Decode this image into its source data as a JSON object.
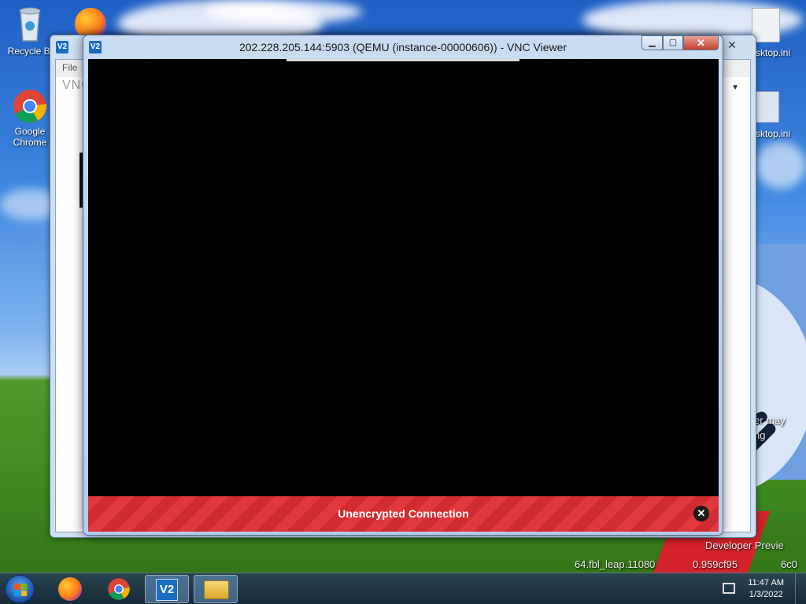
{
  "desktop": {
    "icons": [
      {
        "label": "Recycle Bi",
        "icon": "recycle-bin-icon"
      },
      {
        "label": "Google Chrome",
        "icon": "chrome-icon"
      }
    ],
    "right_labels": [
      "sktop.ini",
      "sktop.ini"
    ],
    "watermark_lines": [
      "er may",
      "ng",
      "Developer Previe",
      "64.fbl_leap.11080",
      "0.959cf95",
      "6c0"
    ]
  },
  "bg_window": {
    "menu_file": "File",
    "brand": "VNC",
    "close_glyph": "✕",
    "dropdown_glyph": "▼"
  },
  "vnc_window": {
    "app_icon_text": "V2",
    "title": "202.228.205.144:5903 (QEMU (instance-00000606)) - VNC Viewer",
    "min_glyph": "▁",
    "max_glyph": "▢",
    "close_glyph": "✕",
    "warning": {
      "text": "Unencrypted Connection",
      "close_glyph": "✕"
    }
  },
  "taskbar": {
    "items": [
      {
        "icon": "firefox-icon"
      },
      {
        "icon": "chrome-icon"
      },
      {
        "icon": "vnc-viewer-icon",
        "label": "V2"
      },
      {
        "icon": "file-explorer-icon"
      }
    ],
    "clock": {
      "time": "11:47 AM",
      "date": "1/3/2022"
    }
  },
  "colors": {
    "warning_red": "#e0383d",
    "window_frame": "#c9dcf3",
    "close_red": "#c4402c"
  }
}
